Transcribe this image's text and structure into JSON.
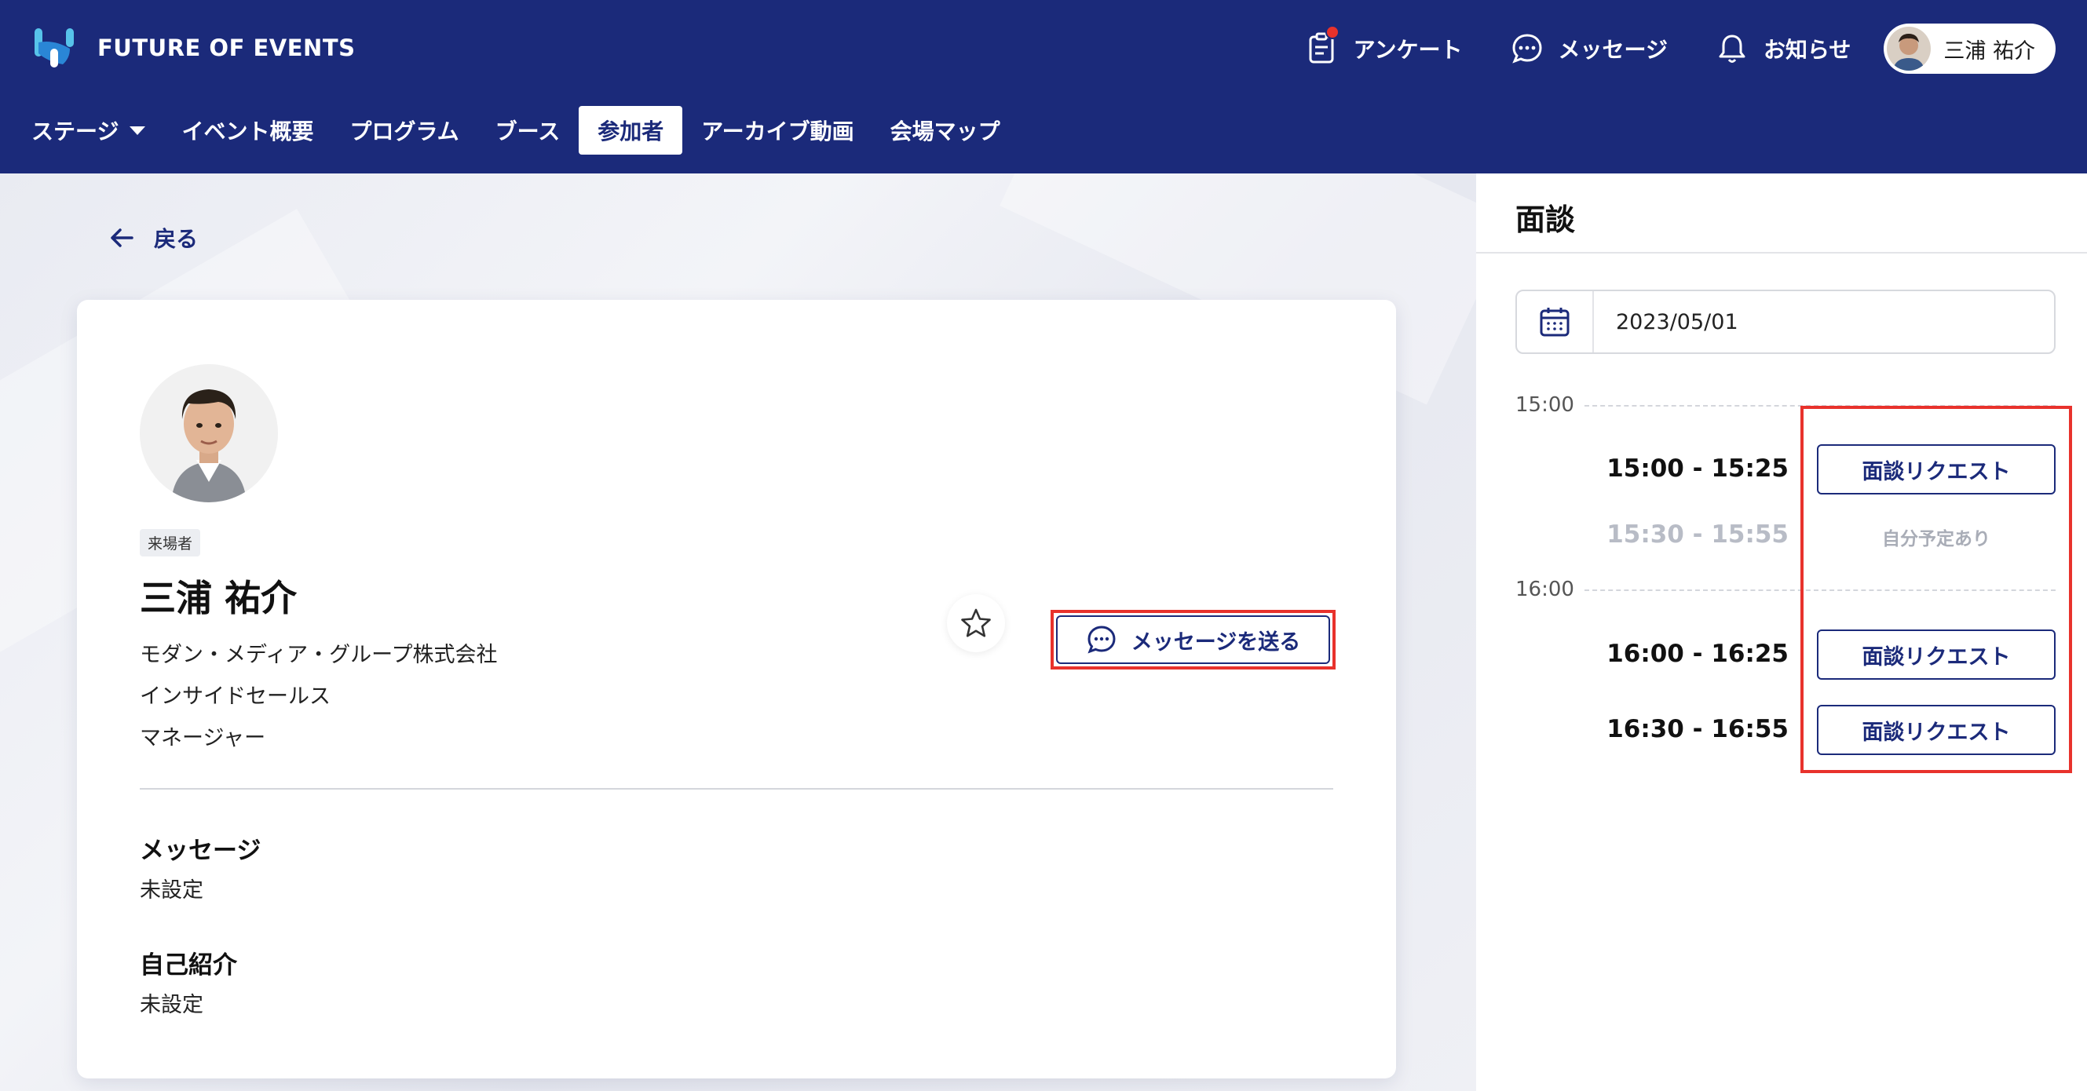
{
  "header": {
    "brand": "FUTURE OF EVENTS",
    "actions": [
      {
        "label": "アンケート",
        "icon": "survey-icon"
      },
      {
        "label": "メッセージ",
        "icon": "chat-icon"
      },
      {
        "label": "お知らせ",
        "icon": "bell-icon"
      }
    ],
    "user_name": "三浦 祐介"
  },
  "nav": {
    "items": [
      {
        "label": "ステージ"
      },
      {
        "label": "イベント概要"
      },
      {
        "label": "プログラム"
      },
      {
        "label": "ブース"
      },
      {
        "label": "参加者"
      },
      {
        "label": "アーカイブ動画"
      },
      {
        "label": "会場マップ"
      }
    ],
    "active": "参加者"
  },
  "profile": {
    "back_label": "戻る",
    "badge": "来場者",
    "name": "三浦 祐介",
    "company": "モダン・メディア・グループ株式会社",
    "department": "インサイドセールス",
    "title": "マネージャー",
    "send_message_label": "メッセージを送る",
    "sections": [
      {
        "label": "メッセージ",
        "value": "未設定"
      },
      {
        "label": "自己紹介",
        "value": "未設定"
      }
    ]
  },
  "meeting": {
    "title": "面談",
    "date": "2023/05/01",
    "hours": [
      "15:00",
      "16:00"
    ],
    "slots": [
      {
        "time": "15:00 - 15:25",
        "status": "available",
        "action": "面談リクエスト"
      },
      {
        "time": "15:30 - 15:55",
        "status": "busy",
        "note": "自分予定あり"
      },
      {
        "time": "16:00 - 16:25",
        "status": "available",
        "action": "面談リクエスト"
      },
      {
        "time": "16:30 - 16:55",
        "status": "available",
        "action": "面談リクエスト"
      }
    ]
  },
  "colors": {
    "header_bg": "#1b2a7a",
    "accent": "#1b2a7a",
    "highlight": "#e8322c",
    "logo_light": "#57c3ea",
    "logo_dark": "#2a86d6"
  }
}
